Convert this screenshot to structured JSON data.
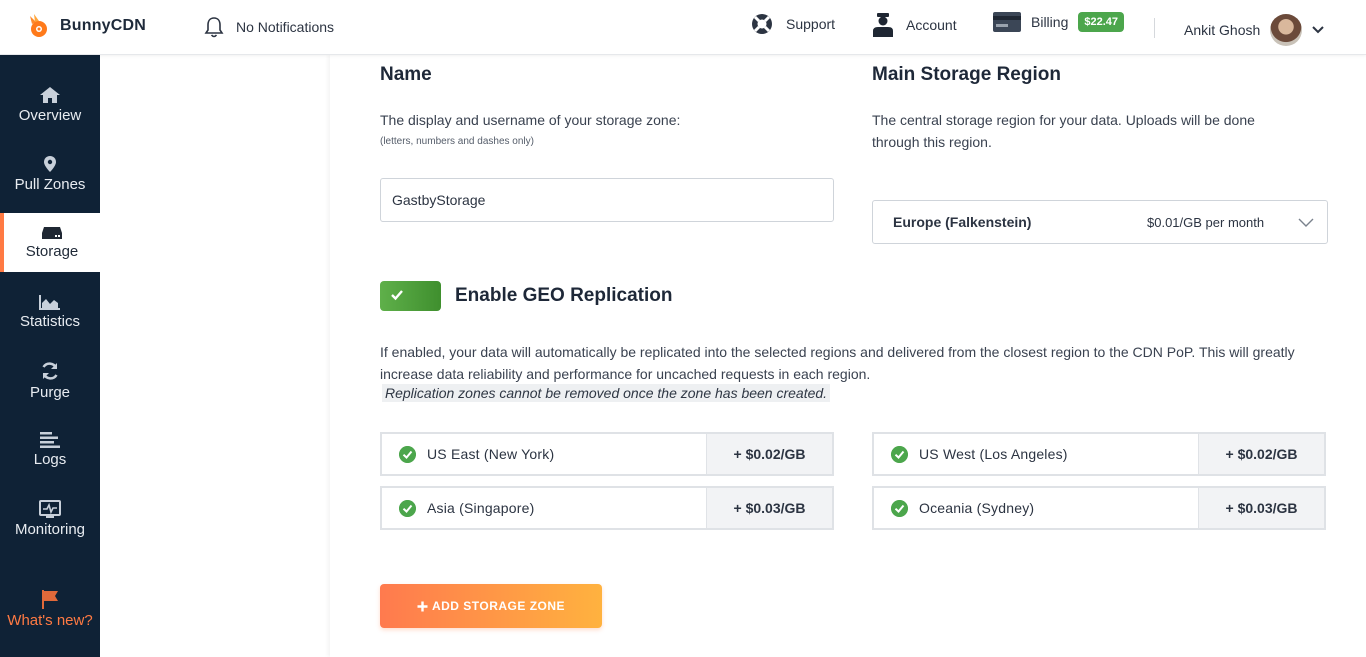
{
  "brand": {
    "name": "BunnyCDN"
  },
  "topbar": {
    "notifications": "No Notifications",
    "support": "Support",
    "account": "Account",
    "billing": "Billing",
    "balance": "$22.47",
    "user": "Ankit Ghosh"
  },
  "sidebar": {
    "items": [
      {
        "label": "Overview",
        "icon": "home-icon"
      },
      {
        "label": "Pull Zones",
        "icon": "map-pin-icon"
      },
      {
        "label": "Storage",
        "icon": "storage-icon"
      },
      {
        "label": "Statistics",
        "icon": "chart-icon"
      },
      {
        "label": "Purge",
        "icon": "refresh-icon"
      },
      {
        "label": "Logs",
        "icon": "list-icon"
      },
      {
        "label": "Monitoring",
        "icon": "monitor-icon"
      }
    ],
    "whats_new": "What's new?"
  },
  "form": {
    "name_heading": "Name",
    "name_desc": "The display and username of your storage zone:",
    "name_hint": "(letters, numbers and dashes only)",
    "name_value": "GastbyStorage",
    "region_heading": "Main Storage Region",
    "region_desc": "The central storage region for your data. Uploads will be done through this region.",
    "region_selected": "Europe (Falkenstein)",
    "region_price": "$0.01/GB per month",
    "geo_title": "Enable GEO Replication",
    "geo_enabled": true,
    "geo_desc": "If enabled, your data will automatically be replicated into the selected regions and delivered from the closest region to the CDN PoP. This will greatly increase data reliability and performance for uncached requests in each region.",
    "geo_note": "Replication zones cannot be removed once the zone has been created.",
    "zones": [
      {
        "name": "US East (New York)",
        "price": "+ $0.02/GB"
      },
      {
        "name": "US West (Los Angeles)",
        "price": "+ $0.02/GB"
      },
      {
        "name": "Asia (Singapore)",
        "price": "+ $0.03/GB"
      },
      {
        "name": "Oceania (Sydney)",
        "price": "+ $0.03/GB"
      }
    ],
    "submit": "ADD STORAGE ZONE"
  },
  "colors": {
    "accent": "#ff7a43",
    "sidebar": "#0f2236",
    "success": "#4ca64c"
  }
}
